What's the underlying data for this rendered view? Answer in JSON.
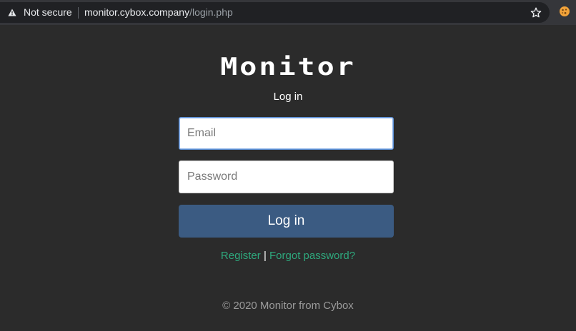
{
  "browser": {
    "security_label": "Not secure",
    "url_host": "monitor.cybox.company",
    "url_path": "/login.php",
    "icons": [
      "warning-icon",
      "star-icon",
      "extension-icon"
    ]
  },
  "page": {
    "logo_text": "Monitor",
    "subtitle": "Log in",
    "email_placeholder": "Email",
    "password_placeholder": "Password",
    "login_button": "Log in",
    "register_link": "Register",
    "link_separator": "|",
    "forgot_link": "Forgot password?",
    "footer": "© 2020 Monitor from Cybox"
  },
  "colors": {
    "background": "#2b2b2b",
    "button": "#3b5b82",
    "link": "#2ea87d",
    "footer_text": "#9a9a9a"
  }
}
